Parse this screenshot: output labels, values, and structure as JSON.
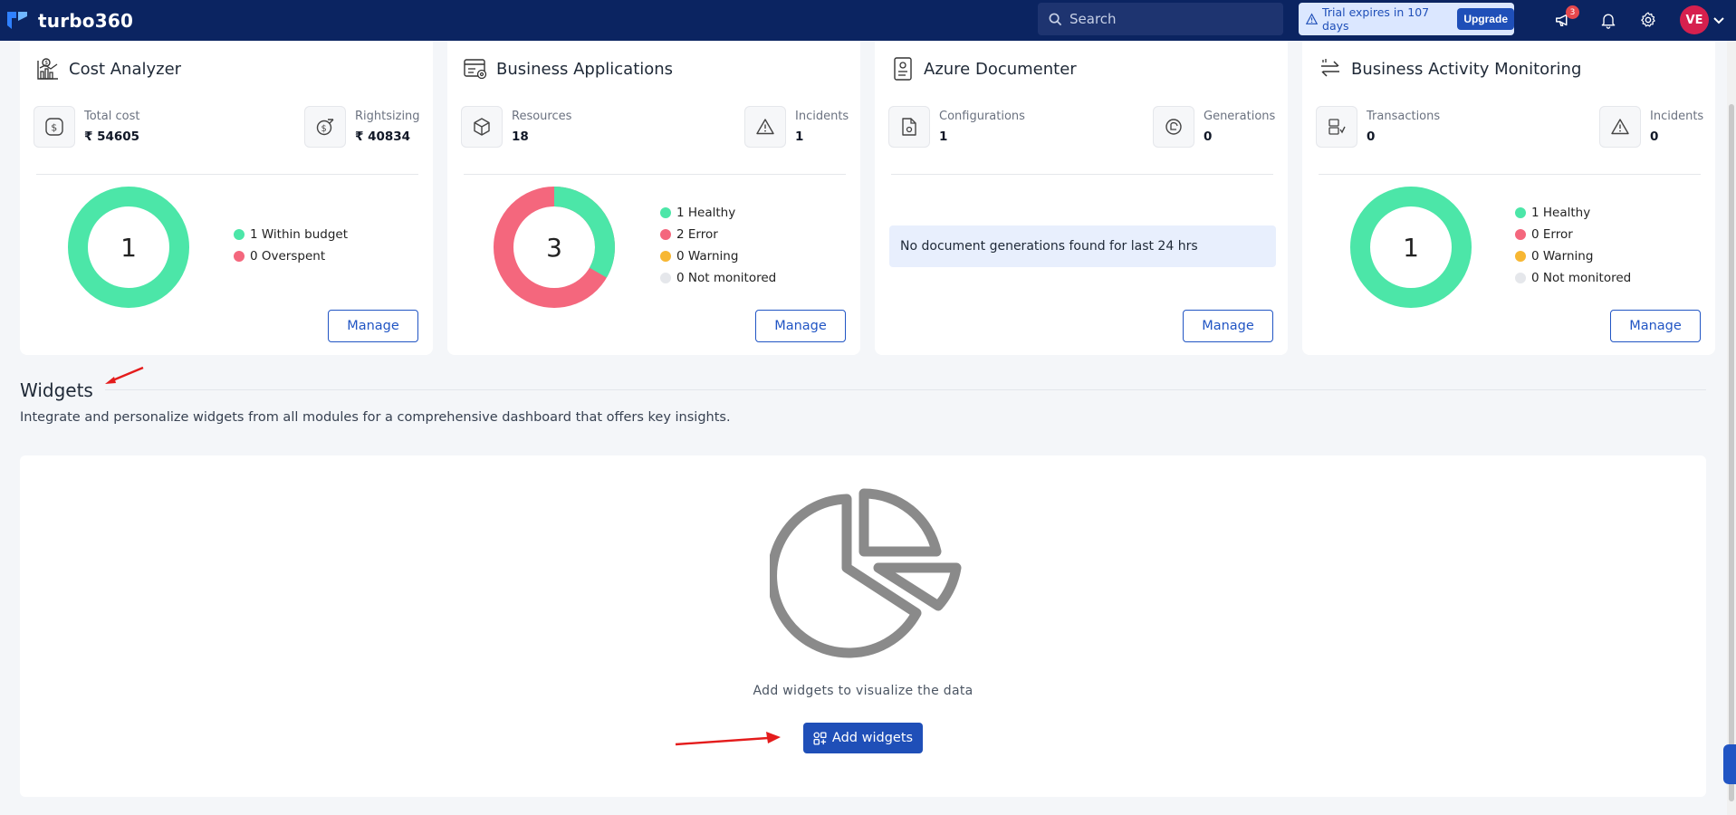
{
  "topbar": {
    "brand": "turbo360",
    "search_placeholder": "Search",
    "trial_text": "Trial expires in 107 days",
    "upgrade_label": "Upgrade",
    "announcements_count": "3",
    "avatar_initials": "VE"
  },
  "cards": [
    {
      "title": "Cost Analyzer",
      "stat_left": {
        "label": "Total cost",
        "value": "₹ 54605"
      },
      "stat_right": {
        "label": "Rightsizing",
        "value": "₹ 40834"
      },
      "donut_total": "1",
      "legend": [
        "1 Within budget",
        "0 Overspent"
      ],
      "manage_label": "Manage"
    },
    {
      "title": "Business Applications",
      "stat_left": {
        "label": "Resources",
        "value": "18"
      },
      "stat_right": {
        "label": "Incidents",
        "value": "1"
      },
      "donut_total": "3",
      "legend": [
        "1 Healthy",
        "2 Error",
        "0 Warning",
        "0 Not monitored"
      ],
      "manage_label": "Manage"
    },
    {
      "title": "Azure Documenter",
      "stat_left": {
        "label": "Configurations",
        "value": "1"
      },
      "stat_right": {
        "label": "Generations",
        "value": "0"
      },
      "note": "No document generations found for last 24 hrs",
      "manage_label": "Manage"
    },
    {
      "title": "Business Activity Monitoring",
      "stat_left": {
        "label": "Transactions",
        "value": "0"
      },
      "stat_right": {
        "label": "Incidents",
        "value": "0"
      },
      "donut_total": "1",
      "legend": [
        "1 Healthy",
        "0 Error",
        "0 Warning",
        "0 Not monitored"
      ],
      "manage_label": "Manage"
    }
  ],
  "status_colors": {
    "healthy": "#4ce6a8",
    "error": "#f4677d",
    "warning": "#f7b733",
    "not_monitored": "#e5e7eb"
  },
  "widgets": {
    "title": "Widgets",
    "description": "Integrate and personalize widgets from all modules for a comprehensive dashboard that offers key insights.",
    "empty_message": "Add widgets to visualize the data",
    "add_label": "Add widgets"
  }
}
